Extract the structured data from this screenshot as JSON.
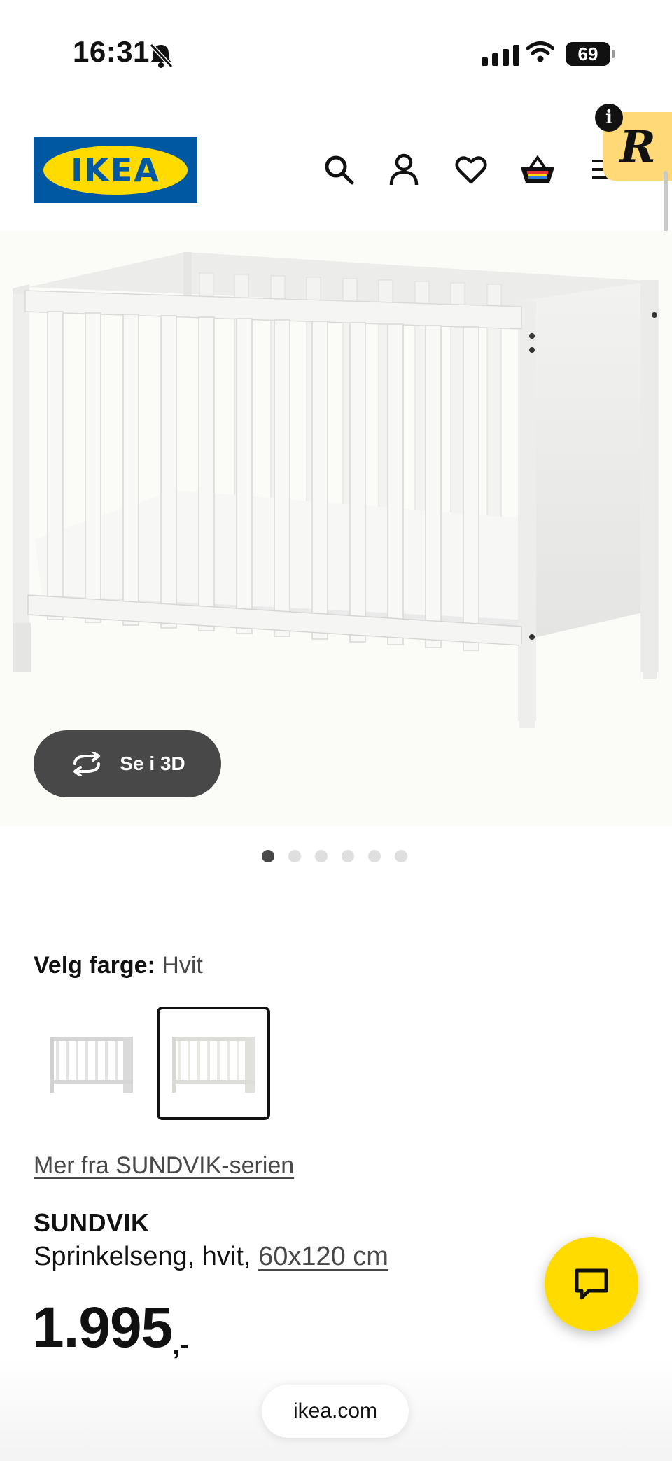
{
  "status_bar": {
    "time": "16:31",
    "battery": "69"
  },
  "header": {
    "logo_text": "IKEA",
    "icons": [
      "search-icon",
      "user-icon",
      "heart-icon",
      "basket-icon",
      "menu-icon"
    ],
    "brand_blue": "#0058A3",
    "brand_yellow": "#FFDB00"
  },
  "gallery": {
    "view_3d_label": "Se i 3D",
    "image_count": 6,
    "active_index": 0
  },
  "colour": {
    "label": "Velg farge:",
    "value": "Hvit"
  },
  "series_link": "Mer fra SUNDVIK-serien",
  "product": {
    "name": "SUNDVIK",
    "description_prefix": "Sprinkelseng, hvit, ",
    "size_link": "60x120 cm",
    "price_main": "1.995",
    "price_suffix": ",-"
  },
  "browser": {
    "url": "ikea.com"
  }
}
